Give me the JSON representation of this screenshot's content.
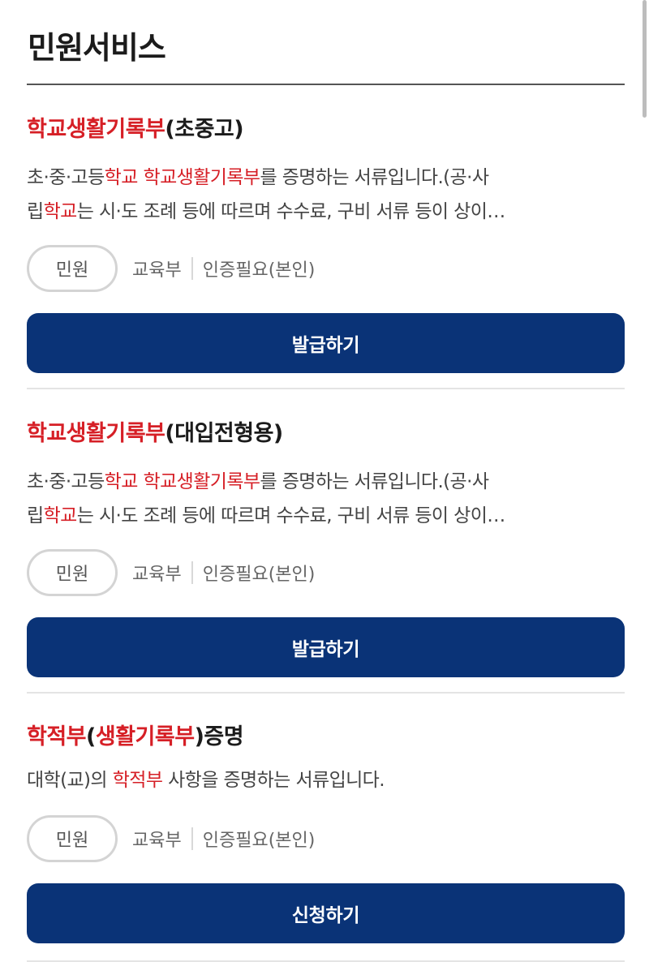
{
  "header": {
    "title": "민원서비스"
  },
  "cards": [
    {
      "title_hl": "학교생활기록부",
      "title_rest": "(초중고)",
      "desc_line1_a": "초·중·고등",
      "desc_line1_hl1": "학교",
      "desc_line1_sp": " ",
      "desc_line1_hl2": "학교생활기록부",
      "desc_line1_b": "를 증명하는 서류입니다.(공·사",
      "desc_line2_a": "립",
      "desc_line2_hl": "학교",
      "desc_line2_b": "는 시·도 조례 등에 따르며 수수료, 구비 서류 등이 상이…",
      "badge": "민원",
      "org": "교육부",
      "auth": "인증필요(본인)",
      "button": "발급하기"
    },
    {
      "title_hl": "학교생활기록부",
      "title_rest": "(대입전형용)",
      "desc_line1_a": "초·중·고등",
      "desc_line1_hl1": "학교",
      "desc_line1_sp": " ",
      "desc_line1_hl2": "학교생활기록부",
      "desc_line1_b": "를 증명하는 서류입니다.(공·사",
      "desc_line2_a": "립",
      "desc_line2_hl": "학교",
      "desc_line2_b": "는 시·도 조례 등에 따르며 수수료, 구비 서류 등이 상이…",
      "badge": "민원",
      "org": "교육부",
      "auth": "인증필요(본인)",
      "button": "발급하기"
    },
    {
      "title_hl1": "학적부",
      "title_p1": "(",
      "title_hl2": "생활기록부",
      "title_p2": ")증명",
      "desc_a": "대학(교)의 ",
      "desc_hl": "학적부",
      "desc_b": " 사항을 증명하는 서류입니다.",
      "badge": "민원",
      "org": "교육부",
      "auth": "인증필요(본인)",
      "button": "신청하기"
    }
  ],
  "colors": {
    "highlight": "#d61f26",
    "button_bg": "#0a3377"
  }
}
